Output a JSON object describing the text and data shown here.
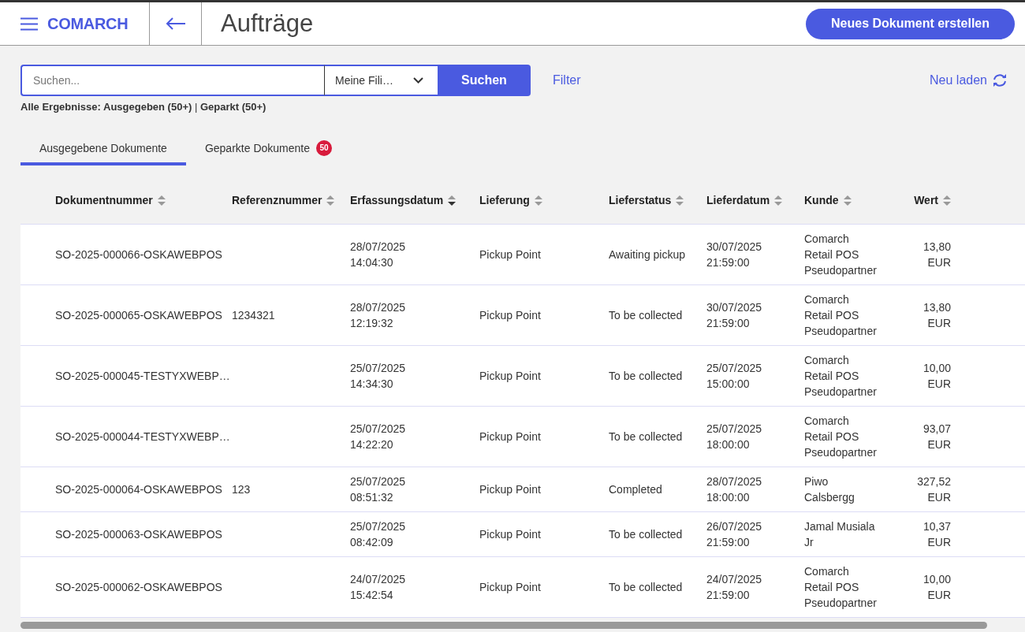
{
  "header": {
    "logo": "COMARCH",
    "title": "Aufträge",
    "new_button": "Neues Dokument erstellen"
  },
  "search": {
    "placeholder": "Suchen...",
    "branch_select": "Meine Fili…",
    "search_button": "Suchen",
    "filter_link": "Filter",
    "reload_link": "Neu laden"
  },
  "summary": "**Alle Ergebnisse: Ausgegeben (50+)** | **Geparkt (50+)**",
  "tabs": [
    {
      "label": "Ausgegebene Dokumente",
      "selected": true
    },
    {
      "label": "Geparkte Dokumente",
      "selected": false,
      "badge": "50"
    }
  ],
  "table": {
    "columns": [
      {
        "label": "Dokumentnummer",
        "sorted_descending": false
      },
      {
        "label": "Referenznummer",
        "sorted_descending": false
      },
      {
        "label": "Erfassungsdatum",
        "sorted_descending": true
      },
      {
        "label": "Lieferung",
        "sorted_descending": false
      },
      {
        "label": "Lieferstatus",
        "sorted_descending": false
      },
      {
        "label": "Lieferdatum",
        "sorted_descending": false
      },
      {
        "label": "Kunde",
        "sorted_descending": false
      },
      {
        "label": "Wert",
        "sorted_descending": false
      }
    ],
    "rows": [
      [
        "SO-2025-000066-OSKAWEBPOS",
        "",
        "28/07/2025\n14:04:30",
        "Pickup Point",
        "Awaiting pickup",
        "30/07/2025\n21:59:00",
        "Comarch\nRetail POS\nPseudopartner",
        "13,80\nEUR"
      ],
      [
        "SO-2025-000065-OSKAWEBPOS",
        "1234321",
        "28/07/2025\n12:19:32",
        "Pickup Point",
        "To be collected",
        "30/07/2025\n21:59:00",
        "Comarch\nRetail POS\nPseudopartner",
        "13,80\nEUR"
      ],
      [
        "SO-2025-000045-TESTYXWEBP…",
        "",
        "25/07/2025\n14:34:30",
        "Pickup Point",
        "To be collected",
        "25/07/2025\n15:00:00",
        "Comarch\nRetail POS\nPseudopartner",
        "10,00\nEUR"
      ],
      [
        "SO-2025-000044-TESTYXWEBP…",
        "",
        "25/07/2025\n14:22:20",
        "Pickup Point",
        "To be collected",
        "25/07/2025\n18:00:00",
        "Comarch\nRetail POS\nPseudopartner",
        "93,07\nEUR"
      ],
      [
        "SO-2025-000064-OSKAWEBPOS",
        "123",
        "25/07/2025\n08:51:32",
        "Pickup Point",
        "Completed",
        "28/07/2025\n18:00:00",
        "Piwo\nCalsbergg",
        "327,52\nEUR"
      ],
      [
        "SO-2025-000063-OSKAWEBPOS",
        "",
        "25/07/2025\n08:42:09",
        "Pickup Point",
        "To be collected",
        "26/07/2025\n21:59:00",
        "Jamal Musiala\nJr",
        "10,37\nEUR"
      ],
      [
        "SO-2025-000062-OSKAWEBPOS",
        "",
        "24/07/2025\n15:42:54",
        "Pickup Point",
        "To be collected",
        "24/07/2025\n21:59:00",
        "Comarch\nRetail POS\nPseudopartner",
        "10,00\nEUR"
      ]
    ]
  }
}
